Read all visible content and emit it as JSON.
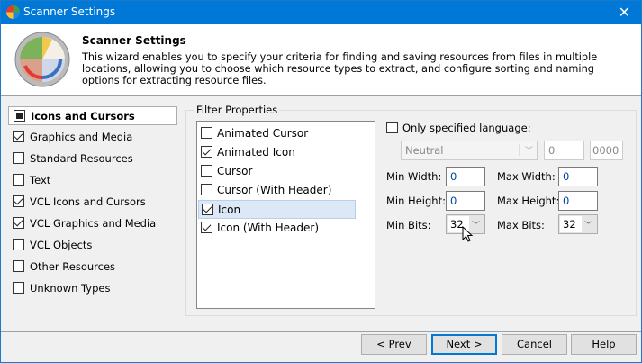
{
  "window": {
    "title": "Scanner Settings",
    "close_icon": "close-icon"
  },
  "header": {
    "title": "Scanner Settings",
    "description": "This wizard enables you to specify your criteria for finding and saving resources from files in multiple locations, allowing you to choose which resource types to extract, and configure sorting and naming options for extracting resource files."
  },
  "categories": [
    {
      "label": "Icons and Cursors",
      "state": "indeterminate",
      "selected": true
    },
    {
      "label": "Graphics and Media",
      "state": "checked"
    },
    {
      "label": "Standard Resources",
      "state": "unchecked"
    },
    {
      "label": "Text",
      "state": "unchecked"
    },
    {
      "label": "VCL Icons and Cursors",
      "state": "checked"
    },
    {
      "label": "VCL Graphics and Media",
      "state": "checked"
    },
    {
      "label": "VCL Objects",
      "state": "unchecked"
    },
    {
      "label": "Other Resources",
      "state": "unchecked"
    },
    {
      "label": "Unknown Types",
      "state": "unchecked"
    }
  ],
  "filter": {
    "title": "Filter Properties",
    "items": [
      {
        "label": "Animated Cursor",
        "checked": false
      },
      {
        "label": "Animated Icon",
        "checked": true
      },
      {
        "label": "Cursor",
        "checked": false
      },
      {
        "label": "Cursor (With Header)",
        "checked": false
      },
      {
        "label": "Icon",
        "checked": true,
        "selected": true
      },
      {
        "label": "Icon (With Header)",
        "checked": true
      }
    ]
  },
  "language": {
    "label": "Only specified language:",
    "checked": false,
    "value": "Neutral",
    "code": "0",
    "hex": "0000"
  },
  "dims": {
    "min_width_label": "Min Width:",
    "min_width": "0",
    "max_width_label": "Max Width:",
    "max_width": "0",
    "min_height_label": "Min Height:",
    "min_height": "0",
    "max_height_label": "Max Height:",
    "max_height": "0",
    "min_bits_label": "Min Bits:",
    "min_bits": "32",
    "max_bits_label": "Max Bits:",
    "max_bits": "32"
  },
  "buttons": {
    "prev": "< Prev",
    "next": "Next >",
    "cancel": "Cancel",
    "help": "Help"
  },
  "colors": {
    "titlebar": "#0078d7",
    "selection": "#dde8f7"
  }
}
